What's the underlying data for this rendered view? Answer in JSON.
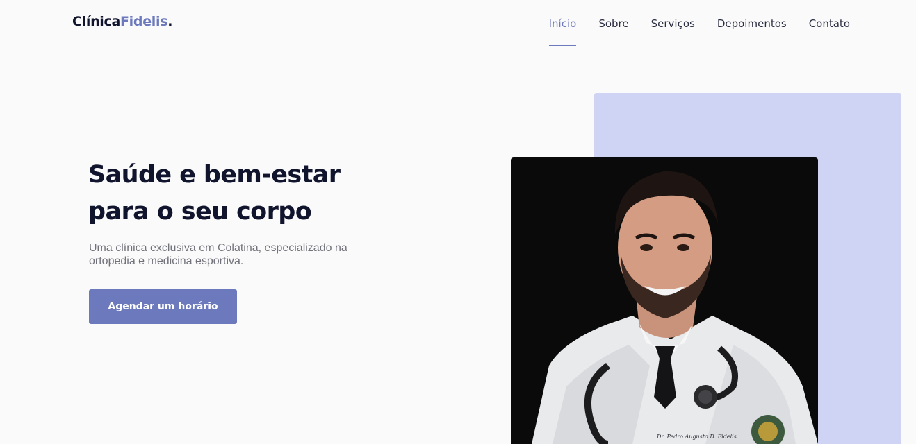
{
  "header": {
    "logo_main": "Clínica",
    "logo_accent": "Fidelis",
    "logo_dot": ".",
    "nav": [
      {
        "label": "Início",
        "active": true
      },
      {
        "label": "Sobre",
        "active": false
      },
      {
        "label": "Serviços",
        "active": false
      },
      {
        "label": "Depoimentos",
        "active": false
      },
      {
        "label": "Contato",
        "active": false
      }
    ]
  },
  "hero": {
    "title_line1": "Saúde e bem-estar",
    "title_line2": "para o seu corpo",
    "subtitle": "Uma clínica exclusiva em Colatina, especializado na ortopedia e medicina esportiva.",
    "cta_label": "Agendar um horário"
  },
  "photo": {
    "coat_embroidery": "Dr. Pedro Augusto D. Fidelis"
  },
  "colors": {
    "accent": "#6c79bd",
    "accent_light": "#cfd3f4",
    "heading": "#11142d",
    "body_text": "#71717a",
    "background": "#fafafa"
  }
}
